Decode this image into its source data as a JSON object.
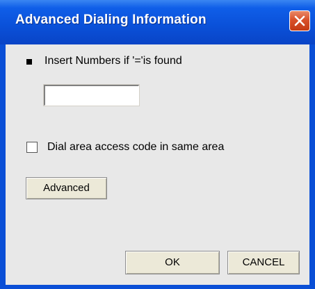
{
  "window": {
    "title": "Advanced Dialing Information"
  },
  "icons": {
    "close": "close-icon",
    "bullet": "square-bullet-icon"
  },
  "insert_numbers": {
    "label": "Insert Numbers if '='is found",
    "value": ""
  },
  "dial_area_access": {
    "label": "Dial area access code in same area",
    "checked": false
  },
  "buttons": {
    "advanced_label": "Advanced",
    "ok_label": "OK",
    "cancel_label": "CANCEL"
  },
  "colors": {
    "titlebar": "#0a50d8",
    "close_button": "#d8502a",
    "client_background": "#e8e8e8",
    "button_face": "#ece9d8"
  }
}
